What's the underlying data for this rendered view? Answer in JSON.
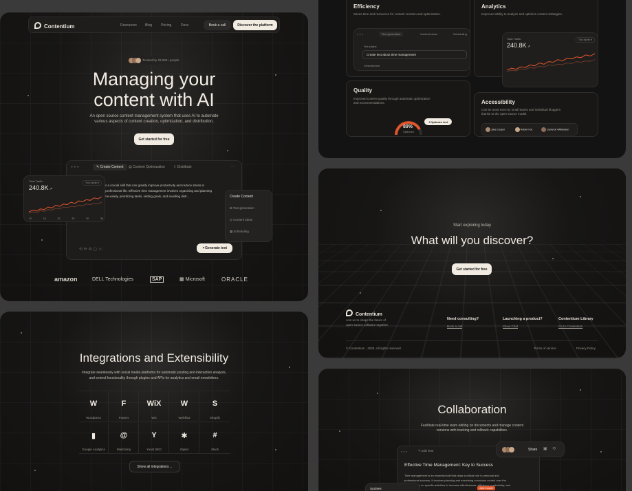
{
  "hero": {
    "brand": "Contentium",
    "nav": [
      "Resources",
      "Blog",
      "Pricing",
      "Docs"
    ],
    "book_call": "Book a call",
    "discover": "Discover the platform",
    "trusted": "Trusted by 20,000+ people",
    "title_line1": "Managing your",
    "title_line2": "content with AI",
    "subtitle_line1": "An open source content management system that uses AI to automate",
    "subtitle_line2": "various aspects of content creation, optimization, and distribution.",
    "cta": "Get started for free",
    "tabs": [
      "Create Content",
      "Content Optimization",
      "Distribute"
    ],
    "editor_text_line1": "nt is a crucial skill that can greatly improve productivity and reduce stress in",
    "editor_text_line2": "nd professional life. Effective time management involves organizing and planning",
    "editor_text_line3": "r time wisely, prioritizing tasks, setting goals, and avoiding distr...",
    "generate": "Generate text",
    "traffic_label": "Total Traffic",
    "traffic_value": "240.8K",
    "traffic_range": "This month",
    "create_menu_title": "Create Content",
    "create_menu_items": [
      "Text generation",
      "Content ideas",
      "Scheduling"
    ],
    "logos": [
      "amazon",
      "DELL Technologies",
      "SAP",
      "Microsoft",
      "ORACLE"
    ]
  },
  "features": {
    "efficiency_title": "Efficiency",
    "efficiency_desc": "Saves time and resources for content creation and optimization.",
    "eff_tabs": [
      "Text generation",
      "Content Ideas",
      "Scheduling"
    ],
    "text_subject_label": "Text subject",
    "text_subject_value": "Create text about time management",
    "generated_label": "Generated text",
    "analytics_title": "Analytics",
    "analytics_desc": "Improved ability to analyze and optimize content strategies.",
    "analytics_label": "Total Traffic",
    "analytics_value": "240.8K",
    "analytics_range": "This Month",
    "quality_title": "Quality",
    "quality_desc_line1": "Improved content quality through automatic optimization",
    "quality_desc_line2": "and recommendations.",
    "quality_value": "89%",
    "quality_label": "Optimized",
    "optimize_btn": "Optimize text",
    "accessibility_title": "Accessibility",
    "accessibility_desc_line1": "Can be used even by small teams and individual bloggers",
    "accessibility_desc_line2": "thanks to the open source model.",
    "people": [
      "Jane Cooper",
      "Robert Fox",
      "Cameron Williamson"
    ]
  },
  "cta_section": {
    "eyebrow": "Start exploring today",
    "title": "What will you discover?",
    "button": "Get started for free"
  },
  "footer": {
    "brand": "Contentium",
    "tagline_line1": "Join us to shape the future of",
    "tagline_line2": "open-source software together.",
    "columns": [
      {
        "title": "Need consulting?",
        "link": "Book a call"
      },
      {
        "title": "Launching a product?",
        "link": "Show Chat"
      },
      {
        "title": "Contentium Library",
        "link": "Go to Contentium"
      }
    ],
    "copyright": "© Contentium , 2025. All rights reserved.",
    "terms": "Terms of service",
    "privacy": "Privacy Policy"
  },
  "integrations": {
    "title": "Integrations and Extensibility",
    "desc_line1": "Integrate seamlessly with social media platforms for automatic posting and interaction analysis,",
    "desc_line2": "and extend functionality through plugins and APIs for analytics and email newsletters.",
    "items": [
      {
        "label": "Wordpress",
        "glyph": "W"
      },
      {
        "label": "Framer",
        "glyph": "F"
      },
      {
        "label": "Wix",
        "glyph": "WiX"
      },
      {
        "label": "Webflow",
        "glyph": "W"
      },
      {
        "label": "Shopify",
        "glyph": "S"
      },
      {
        "label": "Google Analytics",
        "glyph": "▮"
      },
      {
        "label": "Mailchimp",
        "glyph": "@"
      },
      {
        "label": "Yoast SEO",
        "glyph": "Y"
      },
      {
        "label": "Zapier",
        "glyph": "✱"
      },
      {
        "label": "Slack",
        "glyph": "#"
      }
    ],
    "show_all": "Show all integrations"
  },
  "collaboration": {
    "title": "Collaboration",
    "desc_line1": "Facilitate real-time team editing on documents and manage content",
    "desc_line2": "versions with tracking and rollback capabilities.",
    "edit_label": "Edit Text",
    "share": "Share",
    "doc_title": "Effective Time Management: Key to Success",
    "doc_line1": "Time management is an essential skill that plays a critical role in personal and",
    "doc_line2": "professional success. It involves planning and exercising conscious control over the",
    "doc_line3": "of time spent on specific activities to increase effectiveness, efficiency, productivity, and",
    "cursor_name": "Jane Cooper",
    "updates": "Updates"
  },
  "colors": {
    "accent": "#e0552b",
    "cream": "#f1ebe2",
    "bg": "#141313"
  },
  "chart_data": {
    "type": "line",
    "title": "Total Traffic",
    "x": [
      "10",
      "15",
      "20",
      "25",
      "30",
      "35"
    ],
    "series": [
      {
        "values": [
          12,
          18,
          15,
          22,
          20,
          28,
          25,
          34,
          30,
          38,
          36,
          44,
          40,
          48,
          46,
          52,
          50,
          58,
          55,
          62
        ]
      },
      {
        "values": [
          8,
          12,
          10,
          16,
          14,
          20,
          18,
          24,
          22,
          28,
          26,
          30,
          29,
          34,
          32,
          38,
          36,
          40,
          39,
          44
        ]
      }
    ]
  }
}
